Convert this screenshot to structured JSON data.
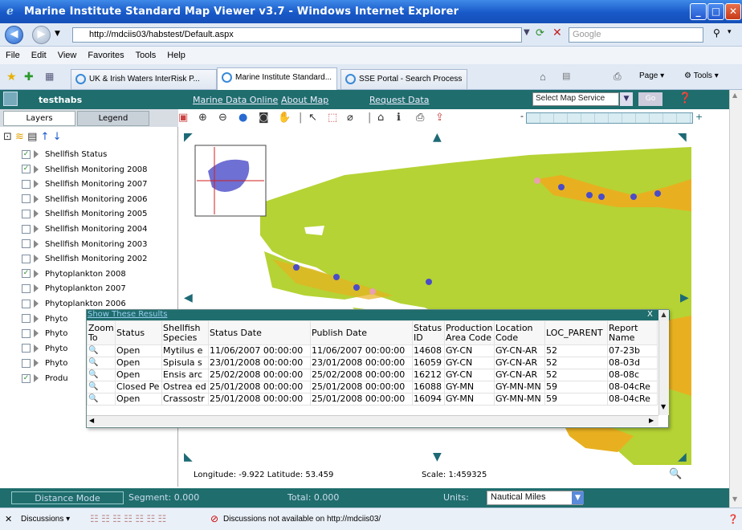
{
  "window": {
    "title": "Marine Institute Standard Map Viewer v3.7 - Windows Internet Explorer"
  },
  "address": {
    "url": "http://mdciis03/habstest/Default.aspx",
    "search_placeholder": "Google"
  },
  "menu": [
    "File",
    "Edit",
    "View",
    "Favorites",
    "Tools",
    "Help"
  ],
  "tabs": [
    {
      "label": "UK & Irish Waters InterRisk P..."
    },
    {
      "label": "Marine Institute Standard...",
      "active": true
    },
    {
      "label": "SSE Portal - Search Process"
    }
  ],
  "commandbar": {
    "page": "Page",
    "tools": "Tools"
  },
  "app": {
    "name": "testhabs",
    "links": [
      "Marine Data Online",
      "About Map",
      "Request Data"
    ],
    "map_service": "Select Map Service",
    "go": "Go"
  },
  "panel": {
    "tabs": [
      "Layers",
      "Legend"
    ],
    "layers": [
      {
        "label": "Shellfish Status",
        "checked": true
      },
      {
        "label": "Shellfish Monitoring 2008",
        "checked": true
      },
      {
        "label": "Shellfish Monitoring 2007",
        "checked": false
      },
      {
        "label": "Shellfish Monitoring 2006",
        "checked": false
      },
      {
        "label": "Shellfish Monitoring 2005",
        "checked": false
      },
      {
        "label": "Shellfish Monitoring 2004",
        "checked": false
      },
      {
        "label": "Shellfish Monitoring 2003",
        "checked": false
      },
      {
        "label": "Shellfish Monitoring 2002",
        "checked": false
      },
      {
        "label": "Phytoplankton 2008",
        "checked": true
      },
      {
        "label": "Phytoplankton 2007",
        "checked": false
      },
      {
        "label": "Phytoplankton 2006",
        "checked": false
      },
      {
        "label": "Phyto",
        "checked": false
      },
      {
        "label": "Phyto",
        "checked": false
      },
      {
        "label": "Phyto",
        "checked": false
      },
      {
        "label": "Phyto",
        "checked": false
      },
      {
        "label": "Produ",
        "checked": true
      }
    ]
  },
  "results": {
    "title": "Show These Results",
    "close": "X",
    "columns": [
      "Zoom To",
      "Status",
      "Shellfish Species",
      "Status Date",
      "Publish Date",
      "Status ID",
      "Production Area Code",
      "Location Code",
      "LOC_PARENT",
      "Report Name"
    ],
    "rows": [
      [
        "Open",
        "Mytilus e",
        "11/06/2007 00:00:00",
        "11/06/2007 00:00:00",
        "14608",
        "GY-CN",
        "GY-CN-AR",
        "52",
        "07-23b"
      ],
      [
        "Open",
        "Spisula s",
        "23/01/2008 00:00:00",
        "23/01/2008 00:00:00",
        "16059",
        "GY-CN",
        "GY-CN-AR",
        "52",
        "08-03d"
      ],
      [
        "Open",
        "Ensis arc",
        "25/02/2008 00:00:00",
        "25/02/2008 00:00:00",
        "16212",
        "GY-CN",
        "GY-CN-AR",
        "52",
        "08-08c"
      ],
      [
        "Closed Pe",
        "Ostrea ed",
        "25/01/2008 00:00:00",
        "25/01/2008 00:00:00",
        "16088",
        "GY-MN",
        "GY-MN-MN",
        "59",
        "08-04cRe"
      ],
      [
        "Open",
        "Crassostr",
        "25/01/2008 00:00:00",
        "25/01/2008 00:00:00",
        "16094",
        "GY-MN",
        "GY-MN-MN",
        "59",
        "08-04cRe"
      ]
    ]
  },
  "map_status": {
    "coords": "Longitude: -9.922 Latitude: 53.459",
    "scale": "Scale: 1:459325"
  },
  "bottom": {
    "distance_mode": "Distance Mode",
    "segment": "Segment: 0.000",
    "total": "Total: 0.000",
    "units_label": "Units:",
    "units_value": "Nautical Miles"
  },
  "ie_status": {
    "discussions": "Discussions",
    "message": "Discussions not available on http://mdciis03/"
  },
  "colors": {
    "land": "#b5d334",
    "sea": "#ffffff",
    "header": "#1f6d6d",
    "sites": "#4a4cc8",
    "coastal": "#e8b020"
  }
}
